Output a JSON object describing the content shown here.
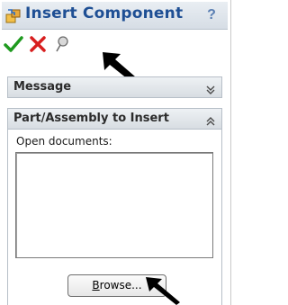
{
  "panel": {
    "title": "Insert Component",
    "help": "?"
  },
  "actions": [
    {
      "name": "ok",
      "icon": "green-check-icon",
      "color": "#1f9a1f"
    },
    {
      "name": "cancel",
      "icon": "red-x-icon",
      "color": "#d81e1e"
    },
    {
      "name": "keep-visible",
      "icon": "pushpin-icon",
      "color": "#7a7a7a"
    }
  ],
  "sections": {
    "message": {
      "label": "Message",
      "state": "collapsed"
    },
    "part_assembly": {
      "label": "Part/Assembly to Insert",
      "state": "expanded",
      "open_documents_label": "Open documents:",
      "open_documents": [],
      "browse_underline": "B",
      "browse_rest": "rowse..."
    }
  },
  "annotations": [
    "pointer-arrow-icon",
    "pointer-arrow-icon"
  ]
}
